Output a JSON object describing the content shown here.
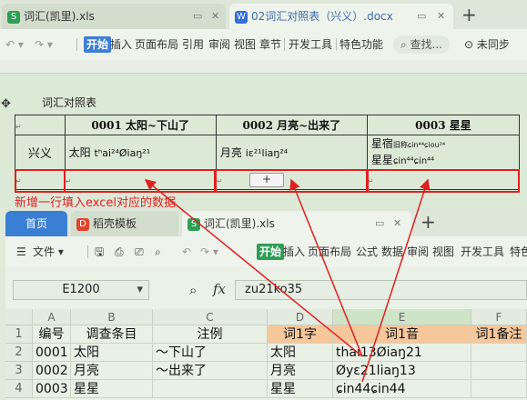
{
  "word": {
    "tabs": [
      {
        "label": "词汇(凯里).xls",
        "icon": "S",
        "icon_color": "#2f9e55"
      },
      {
        "label": "02词汇对照表（兴义）.docx",
        "icon": "W",
        "icon_color": "#2f6fd6"
      }
    ],
    "toolbar": {
      "start": "开始",
      "items": [
        "插入",
        "页面布局",
        "引用",
        "审阅",
        "视图",
        "章节",
        "开发工具",
        "特色功能"
      ],
      "search": "查找...",
      "sync": "未同步"
    },
    "doc_title": "词汇对照表",
    "table": {
      "headers": [
        "0001 太阳~下山了",
        "0002 月亮~出来了",
        "0003 星星"
      ],
      "row_label": "兴义",
      "cells": [
        {
          "word": "太阳",
          "ipa": "tʰai²⁴Øiaŋ²¹"
        },
        {
          "word": "月亮",
          "ipa": "iɛ²¹liaŋ²⁴"
        },
        {
          "line1": "星宿",
          "line1_ipa": "旧称ɕin⁴⁴ɕiou²⁴",
          "line2": "星星",
          "line2_ipa": "ɕin⁴⁴ɕin⁴⁴"
        }
      ],
      "add_row_symbol": "+"
    },
    "annotation": "新增一行填入excel对应的数据"
  },
  "excel": {
    "tabs": [
      {
        "label": "首页"
      },
      {
        "label": "稻壳模板"
      },
      {
        "label": "词汇(凯里).xls"
      }
    ],
    "toolbar": {
      "file": "文件",
      "start": "开始",
      "items": [
        "插入",
        "页面布局",
        "公式",
        "数据",
        "审阅",
        "视图",
        "开发工具",
        "特色"
      ]
    },
    "name_box": "E1200",
    "fx": "fx",
    "formula_value": "zu21ko35",
    "columns": [
      "A",
      "B",
      "C",
      "D",
      "E",
      "F"
    ],
    "rows": [
      {
        "num": "1",
        "cells": [
          "编号",
          "调查条目",
          "注例",
          "词1字",
          "词1音",
          "词1备注"
        ]
      },
      {
        "num": "2",
        "cells": [
          "0001",
          "太阳",
          "～下山了",
          "太阳",
          "thai13Øiaŋ21",
          ""
        ]
      },
      {
        "num": "3",
        "cells": [
          "0002",
          "月亮",
          "～出来了",
          "月亮",
          "Øyɛ21liaŋ13",
          ""
        ]
      },
      {
        "num": "4",
        "cells": [
          "0003",
          "星星",
          "",
          "星星",
          "ɕin44ɕin44",
          ""
        ]
      }
    ],
    "accent": "#2f9e55",
    "header_fill": "#f6c79b"
  },
  "arrow_color": "#e02020"
}
